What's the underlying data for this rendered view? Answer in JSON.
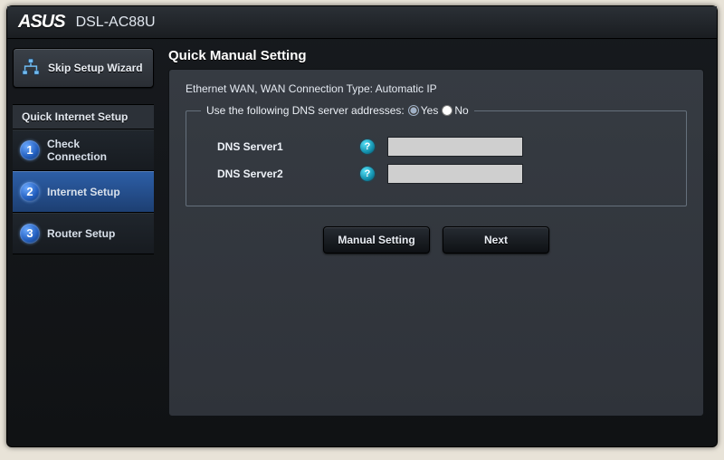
{
  "header": {
    "brand": "ASUS",
    "model": "DSL-AC88U"
  },
  "sidebar": {
    "skip_label": "Skip Setup Wizard",
    "panel_title": "Quick Internet Setup",
    "steps": [
      {
        "num": "1",
        "label": "Check\nConnection",
        "selected": false
      },
      {
        "num": "2",
        "label": "Internet Setup",
        "selected": true
      },
      {
        "num": "3",
        "label": "Router Setup",
        "selected": false
      }
    ]
  },
  "main": {
    "page_title": "Quick Manual Setting",
    "subtitle": "Ethernet WAN, WAN Connection Type: Automatic IP",
    "dns": {
      "legend": "Use the following DNS server addresses:",
      "yes": "Yes",
      "no": "No",
      "selected": "yes",
      "rows": [
        {
          "label": "DNS Server1",
          "value": ""
        },
        {
          "label": "DNS Server2",
          "value": ""
        }
      ]
    },
    "buttons": {
      "manual": "Manual Setting",
      "next": "Next"
    }
  }
}
